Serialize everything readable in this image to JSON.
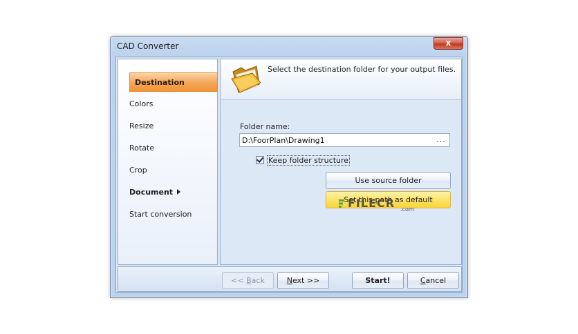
{
  "window": {
    "title": "CAD Converter",
    "close_label": "x"
  },
  "nav": {
    "items": [
      {
        "label": "Destination",
        "active": true
      },
      {
        "label": "Colors"
      },
      {
        "label": "Resize"
      },
      {
        "label": "Rotate"
      },
      {
        "label": "Crop"
      },
      {
        "label": "Document",
        "has_submenu": true
      },
      {
        "label": "Start conversion"
      }
    ]
  },
  "content": {
    "header_text": "Select the destination folder for your output files.",
    "folder_label": "Folder name:",
    "folder_value": "D:\\FoorPlan\\Drawing1",
    "browse_label": "...",
    "keep_structure_label": "Keep folder structure",
    "keep_structure_checked": true,
    "use_source_label": "Use source folder",
    "set_default_label": "Set this path as default",
    "watermark": {
      "text": "FILECR",
      "suffix": ".com"
    }
  },
  "footer": {
    "back_prefix": "<< ",
    "back_key": "B",
    "back_rest": "ack",
    "next_key": "N",
    "next_rest": "ext >>",
    "start_label": "Start!",
    "cancel_key": "C",
    "cancel_rest": "ancel"
  },
  "colors": {
    "active_nav": "#f6a55a",
    "default_button": "#fde269",
    "window_frame": "#bcd3ee"
  },
  "icons": {
    "header": "open-folder-icon",
    "close": "close-icon"
  }
}
